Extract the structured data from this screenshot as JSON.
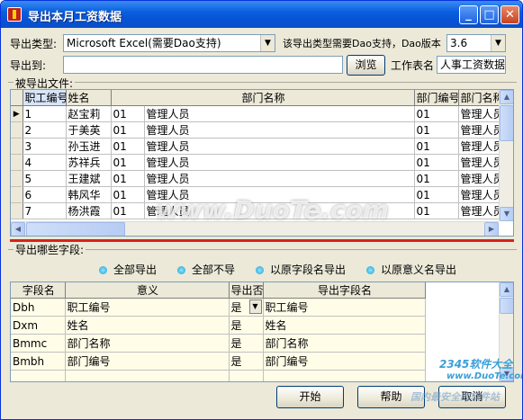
{
  "window": {
    "title": "导出本月工资数据"
  },
  "form": {
    "export_type_label": "导出类型:",
    "export_type_value": "Microsoft Excel(需要Dao支持)",
    "dao_note": "该导出类型需要Dao支持，Dao版本",
    "dao_version": "3.6",
    "export_to_label": "导出到:",
    "export_to_value": "",
    "browse_label": "浏览",
    "sheet_name_label": "工作表名",
    "sheet_name_value": "人事工资数据"
  },
  "exported_file": {
    "group_label": "被导出文件:",
    "columns": [
      "职工编号",
      "姓名",
      "部门名称",
      "部门编号",
      "部门名称（不带"
    ],
    "rows": [
      [
        "1",
        "赵宝莉",
        "01",
        "管理人员",
        "01",
        "管理人员"
      ],
      [
        "2",
        "于美英",
        "01",
        "管理人员",
        "01",
        "管理人员"
      ],
      [
        "3",
        "孙玉进",
        "01",
        "管理人员",
        "01",
        "管理人员"
      ],
      [
        "4",
        "苏祥兵",
        "01",
        "管理人员",
        "01",
        "管理人员"
      ],
      [
        "5",
        "王建斌",
        "01",
        "管理人员",
        "01",
        "管理人员"
      ],
      [
        "6",
        "韩风华",
        "01",
        "管理人员",
        "01",
        "管理人员"
      ],
      [
        "7",
        "杨洪霞",
        "01",
        "管理人员",
        "01",
        "管理人员"
      ]
    ]
  },
  "fields_section": {
    "group_label": "导出哪些字段:",
    "options": [
      "全部导出",
      "全部不导",
      "以原字段名导出",
      "以原意义名导出"
    ],
    "columns": [
      "字段名",
      "意义",
      "导出否",
      "导出字段名"
    ],
    "rows": [
      {
        "field": "Dbh",
        "meaning": "职工编号",
        "export": "是",
        "export_name": "职工编号"
      },
      {
        "field": "Dxm",
        "meaning": "姓名",
        "export": "是",
        "export_name": "姓名"
      },
      {
        "field": "Bmmc",
        "meaning": "部门名称",
        "export": "是",
        "export_name": "部门名称"
      },
      {
        "field": "Bmbh",
        "meaning": "部门编号",
        "export": "是",
        "export_name": "部门编号"
      },
      {
        "field": "",
        "meaning": "",
        "export": "",
        "export_name": ""
      }
    ]
  },
  "buttons": {
    "start": "开始",
    "help": "帮助",
    "cancel": "取消"
  },
  "watermarks": {
    "center": "www.DuoTe.com",
    "corner_brand": "2345软件大全",
    "corner_url": "www.DuoTe.com",
    "corner_tagline": "国内最安全的软件站"
  }
}
